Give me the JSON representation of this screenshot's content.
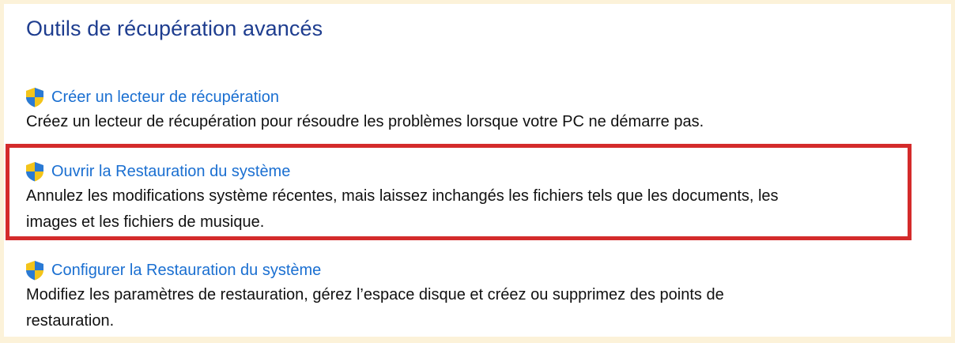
{
  "section": {
    "title": "Outils de récupération avancés"
  },
  "items": [
    {
      "link": "Créer un lecteur de récupération",
      "description": "Créez un lecteur de récupération pour résoudre les problèmes lorsque votre PC ne démarre pas."
    },
    {
      "link": "Ouvrir la Restauration du système",
      "description_line1": "Annulez les modifications système récentes, mais laissez inchangés les fichiers tels que les documents, les",
      "description_line2": "images et les fichiers de musique."
    },
    {
      "link": "Configurer la Restauration du système",
      "description_line1": "Modifiez les paramètres de restauration, gérez l’espace disque et créez ou supprimez des points de",
      "description_line2": "restauration."
    }
  ],
  "icons": {
    "item_icon": "uac-shield-icon"
  },
  "colors": {
    "background_frame": "#fcf2d9",
    "title": "#1e3d8f",
    "link": "#1a6fd1",
    "highlight_border": "#d42b2b"
  }
}
